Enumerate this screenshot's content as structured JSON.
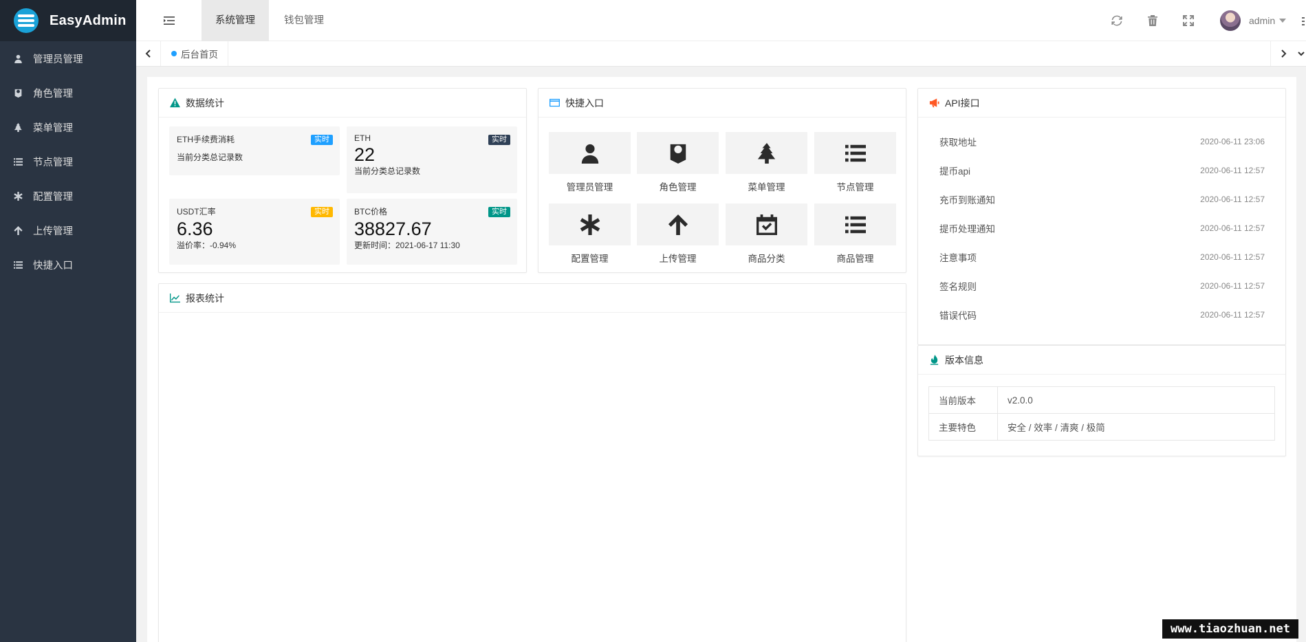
{
  "brand": {
    "name": "EasyAdmin"
  },
  "sidebar": {
    "items": [
      {
        "label": "管理员管理",
        "icon": "user-icon"
      },
      {
        "label": "角色管理",
        "icon": "role-icon"
      },
      {
        "label": "菜单管理",
        "icon": "tree-icon"
      },
      {
        "label": "节点管理",
        "icon": "list-icon"
      },
      {
        "label": "配置管理",
        "icon": "asterisk-icon"
      },
      {
        "label": "上传管理",
        "icon": "arrow-up-icon"
      },
      {
        "label": "快捷入口",
        "icon": "list-icon"
      }
    ]
  },
  "header": {
    "tabs": [
      {
        "label": "系统管理",
        "active": true
      },
      {
        "label": "钱包管理",
        "active": false
      }
    ],
    "username": "admin"
  },
  "tabbar": {
    "current": "后台首页"
  },
  "stats": {
    "title": "数据统计",
    "items": [
      {
        "title": "ETH手续费消耗",
        "badge": "实时",
        "badge_color": "#1e9fff",
        "value": "",
        "desc": "当前分类总记录数"
      },
      {
        "title": "ETH",
        "badge": "实时",
        "badge_color": "#2f4056",
        "value": "22",
        "desc": "当前分类总记录数"
      },
      {
        "title": "USDT汇率",
        "badge": "实时",
        "badge_color": "#ffb800",
        "value": "6.36",
        "desc": "溢价率：-0.94%"
      },
      {
        "title": "BTC价格",
        "badge": "实时",
        "badge_color": "#009688",
        "value": "38827.67",
        "desc": "更新时间：2021-06-17 11:30"
      }
    ]
  },
  "shortcuts": {
    "title": "快捷入口",
    "items": [
      {
        "label": "管理员管理",
        "icon": "user-icon"
      },
      {
        "label": "角色管理",
        "icon": "role-icon"
      },
      {
        "label": "菜单管理",
        "icon": "tree-icon"
      },
      {
        "label": "节点管理",
        "icon": "list-icon"
      },
      {
        "label": "配置管理",
        "icon": "asterisk-icon"
      },
      {
        "label": "上传管理",
        "icon": "arrow-up-icon"
      },
      {
        "label": "商品分类",
        "icon": "calendar-check-icon"
      },
      {
        "label": "商品管理",
        "icon": "list-icon"
      }
    ]
  },
  "report": {
    "title": "报表统计"
  },
  "api": {
    "title": "API接口",
    "items": [
      {
        "name": "获取地址",
        "time": "2020-06-11 23:06"
      },
      {
        "name": "提币api",
        "time": "2020-06-11 12:57"
      },
      {
        "name": "充币到账通知",
        "time": "2020-06-11 12:57"
      },
      {
        "name": "提币处理通知",
        "time": "2020-06-11 12:57"
      },
      {
        "name": "注意事项",
        "time": "2020-06-11 12:57"
      },
      {
        "name": "签名规则",
        "time": "2020-06-11 12:57"
      },
      {
        "name": "错误代码",
        "time": "2020-06-11 12:57"
      }
    ]
  },
  "version": {
    "title": "版本信息",
    "rows": [
      {
        "key": "当前版本",
        "value": "v2.0.0"
      },
      {
        "key": "主要特色",
        "value": "安全 / 效率 / 清爽 / 极简"
      }
    ]
  },
  "watermark": "www.tiaozhuan.net",
  "colors": {
    "sidebar_bg": "#2a3442",
    "logo_bg": "#1f2731",
    "accent": "#1e9fff",
    "teal": "#009688"
  }
}
